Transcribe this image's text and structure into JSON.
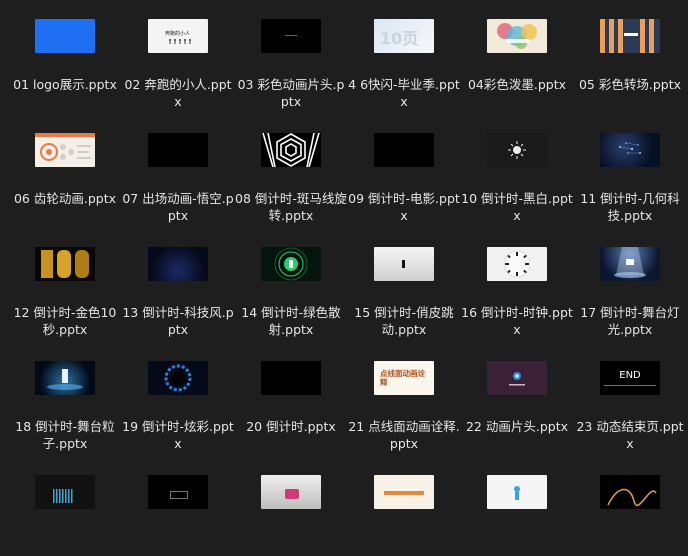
{
  "files": [
    {
      "label": "01 logo展示.pptx"
    },
    {
      "label": "02 奔跑的小人.pptx",
      "thumb_text": "奔跑的小人"
    },
    {
      "label": "03 彩色动画片头.pptx"
    },
    {
      "label": "4 6快闪-毕业季.pptx",
      "thumb_text": "10页"
    },
    {
      "label": "04彩色泼墨.pptx"
    },
    {
      "label": "05 彩色转场.pptx"
    },
    {
      "label": "06 齿轮动画.pptx"
    },
    {
      "label": "07 出场动画-悟空.pptx"
    },
    {
      "label": "08 倒计时-斑马线旋转.pptx"
    },
    {
      "label": "09 倒计时-电影.pptx"
    },
    {
      "label": "10 倒计时-黑白.pptx"
    },
    {
      "label": "11 倒计时-几何科技.pptx"
    },
    {
      "label": "12 倒计时-金色10秒.pptx"
    },
    {
      "label": "13 倒计时-科技风.pptx"
    },
    {
      "label": "14 倒计时-绿色散射.pptx"
    },
    {
      "label": "15 倒计时-俏皮跳动.pptx"
    },
    {
      "label": "16 倒计时-时钟.pptx"
    },
    {
      "label": "17 倒计时-舞台灯光.pptx"
    },
    {
      "label": "18 倒计时-舞台粒子.pptx"
    },
    {
      "label": "19 倒计时-炫彩.pptx"
    },
    {
      "label": "20 倒计时.pptx"
    },
    {
      "label": "21 点线面动画诠释.pptx",
      "thumb_text": "点线面动画诠释"
    },
    {
      "label": "22 动画片头.pptx"
    },
    {
      "label": "23 动态结束页.pptx",
      "thumb_text": "END"
    }
  ]
}
